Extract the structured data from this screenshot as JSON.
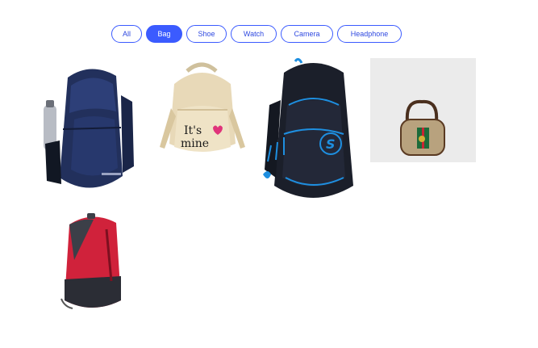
{
  "filters": {
    "items": [
      {
        "label": "All",
        "active": false
      },
      {
        "label": "Bag",
        "active": true
      },
      {
        "label": "Shoe",
        "active": false
      },
      {
        "label": "Watch",
        "active": false
      },
      {
        "label": "Camera",
        "active": false
      },
      {
        "label": "Headphone",
        "active": false
      }
    ]
  },
  "products": {
    "bag1": {
      "print_text": "IT'S MINE",
      "print_line1": "It's",
      "print_line2": "mine",
      "icon": "heart-icon"
    },
    "colors": {
      "navy": "#22305c",
      "cream": "#e8d9b8",
      "black": "#1b1f2a",
      "blue_accent": "#1e8fe0",
      "red": "#d0223b",
      "gray_bg": "#ebebeb"
    }
  }
}
